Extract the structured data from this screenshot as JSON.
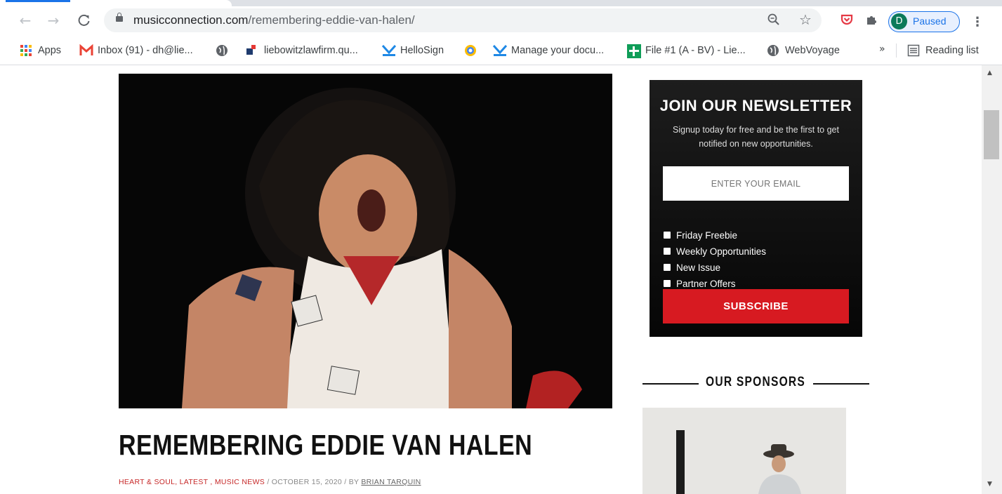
{
  "browser": {
    "url_domain": "musicconnection.com",
    "url_path": "/remembering-eddie-van-halen/",
    "profile_initial": "D",
    "profile_label": "Paused",
    "bookmarks": [
      {
        "label": "Apps",
        "icon": "apps-grid-icon"
      },
      {
        "label": "Inbox (91) - dh@lie...",
        "icon": "gmail-icon"
      },
      {
        "label": "",
        "icon": "globe-icon"
      },
      {
        "label": "liebowitzlawfirm.qu...",
        "icon": "site-icon"
      },
      {
        "label": "HelloSign",
        "icon": "hellosign-icon"
      },
      {
        "label": "",
        "icon": "drive-icon"
      },
      {
        "label": "Manage your docu...",
        "icon": "hellosign-icon"
      },
      {
        "label": "File #1 (A - BV) - Lie...",
        "icon": "sheets-icon"
      },
      {
        "label": "WebVoyage",
        "icon": "globe-icon"
      }
    ],
    "more_chevron": "»",
    "reading_list": "Reading list"
  },
  "article": {
    "title": "REMEMBERING EDDIE VAN HALEN",
    "categories": "HEART & SOUL, LATEST , MUSIC NEWS",
    "separator": "/",
    "date": "OCTOBER 15, 2020 /",
    "by": "BY",
    "author": "BRIAN TARQUIN"
  },
  "newsletter": {
    "title": "JOIN OUR NEWSLETTER",
    "text": "Signup today for free and be the first to get notified on new opportunities.",
    "email_placeholder": "ENTER YOUR EMAIL",
    "options": [
      "Friday Freebie",
      "Weekly Opportunities",
      "New Issue",
      "Partner Offers"
    ],
    "subscribe_label": "SUBSCRIBE"
  },
  "sponsors": {
    "title": "OUR SPONSORS"
  },
  "colors": {
    "accent_red": "#d71a21",
    "category_red": "#c62828",
    "chrome_blue": "#1a73e8"
  }
}
